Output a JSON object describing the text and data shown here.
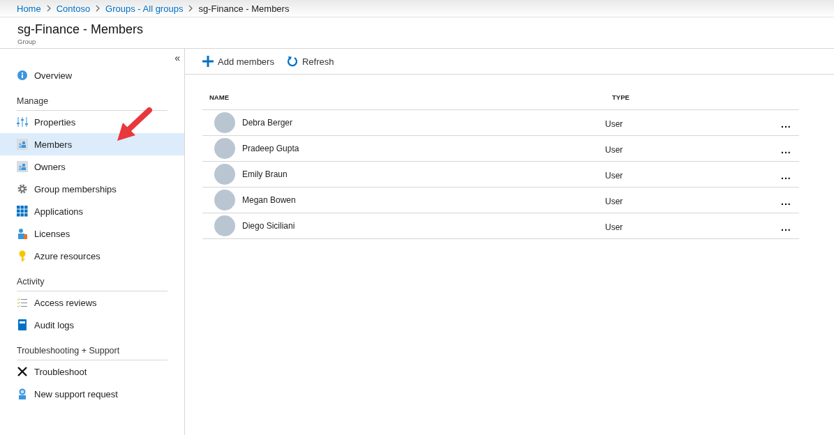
{
  "breadcrumb": [
    {
      "label": "Home",
      "link": true
    },
    {
      "label": "Contoso",
      "link": true
    },
    {
      "label": "Groups - All groups",
      "link": true
    },
    {
      "label": "sg-Finance - Members",
      "link": false
    }
  ],
  "header": {
    "title": "sg-Finance - Members",
    "subtitle": "Group"
  },
  "sidebar": {
    "collapse": "«",
    "sections": [
      {
        "items": [
          {
            "label": "Overview",
            "selected": false
          }
        ]
      },
      {
        "heading": "Manage",
        "items": [
          {
            "label": "Properties",
            "selected": false
          },
          {
            "label": "Members",
            "selected": true
          },
          {
            "label": "Owners",
            "selected": false
          },
          {
            "label": "Group memberships",
            "selected": false
          },
          {
            "label": "Applications",
            "selected": false
          },
          {
            "label": "Licenses",
            "selected": false
          },
          {
            "label": "Azure resources",
            "selected": false
          }
        ]
      },
      {
        "heading": "Activity",
        "items": [
          {
            "label": "Access reviews",
            "selected": false
          },
          {
            "label": "Audit logs",
            "selected": false
          }
        ]
      },
      {
        "heading": "Troubleshooting + Support",
        "items": [
          {
            "label": "Troubleshoot",
            "selected": false
          },
          {
            "label": "New support request",
            "selected": false
          }
        ]
      }
    ]
  },
  "toolbar": [
    {
      "label": "Add members",
      "kind": "add"
    },
    {
      "label": "Refresh",
      "kind": "refresh"
    }
  ],
  "table": {
    "columns": [
      "NAME",
      "TYPE"
    ],
    "more": "...",
    "rows": [
      {
        "name": "Debra Berger",
        "type": "User"
      },
      {
        "name": "Pradeep Gupta",
        "type": "User"
      },
      {
        "name": "Emily Braun",
        "type": "User"
      },
      {
        "name": "Megan Bowen",
        "type": "User"
      },
      {
        "name": "Diego Siciliani",
        "type": "User"
      }
    ]
  }
}
